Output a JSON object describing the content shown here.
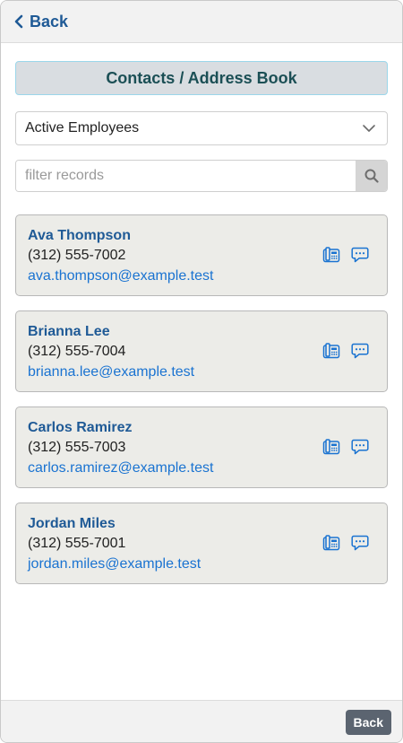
{
  "header": {
    "back_label": "Back"
  },
  "page": {
    "title": "Contacts / Address Book"
  },
  "group_select": {
    "selected": "Active Employees"
  },
  "search": {
    "placeholder": "filter records",
    "value": ""
  },
  "contacts": [
    {
      "name": "Ava Thompson",
      "phone": "(312) 555-7002",
      "email": "ava.thompson@example.test"
    },
    {
      "name": "Brianna Lee",
      "phone": "(312) 555-7004",
      "email": "brianna.lee@example.test"
    },
    {
      "name": "Carlos Ramirez",
      "phone": "(312) 555-7003",
      "email": "carlos.ramirez@example.test"
    },
    {
      "name": "Jordan Miles",
      "phone": "(312) 555-7001",
      "email": "jordan.miles@example.test"
    }
  ],
  "icons": {
    "back": "chevron-left-icon",
    "dropdown": "chevron-down-icon",
    "search": "search-icon",
    "call": "fax-phone-icon",
    "message": "chat-bubble-icon"
  },
  "colors": {
    "accent": "#1f5a96",
    "link": "#1a73d1",
    "card_bg": "#ecece8",
    "banner_bg": "#d9dde1",
    "banner_border": "#9bd6ea",
    "footer_button": "#5b6470"
  },
  "footer": {
    "back_label": "Back"
  }
}
